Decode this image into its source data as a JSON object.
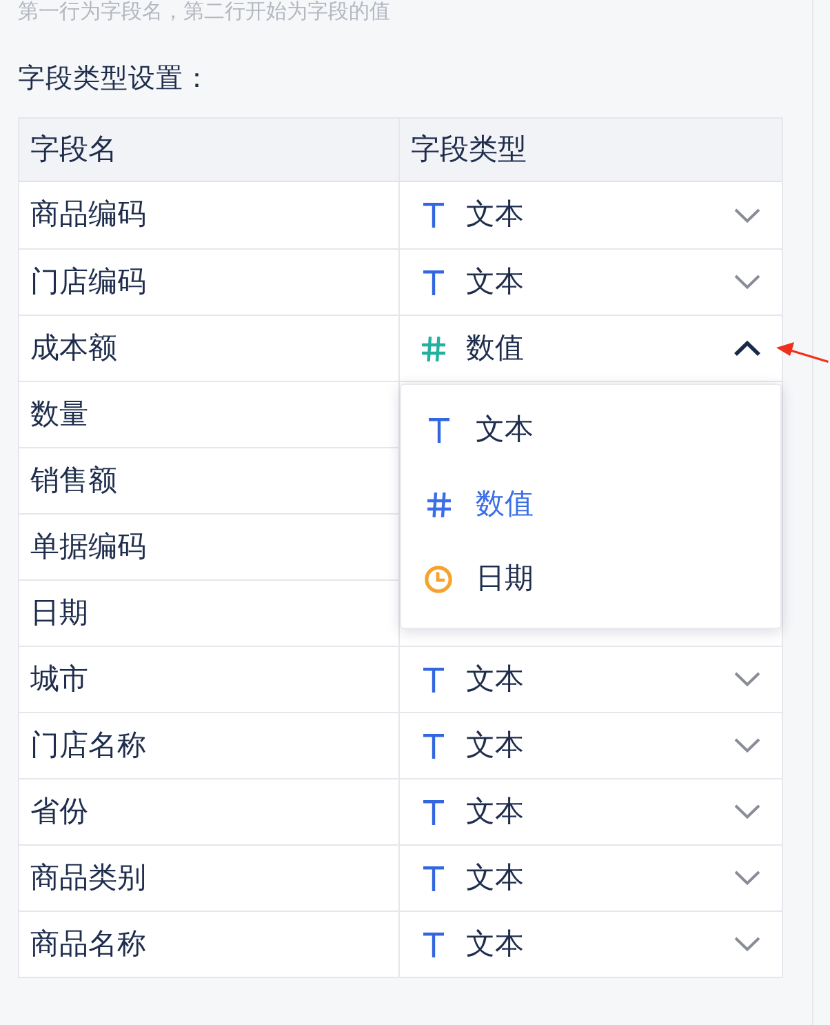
{
  "note": "第一行为字段名，第二行开始为字段的值",
  "section_title": "字段类型设置：",
  "table": {
    "columns": [
      "字段名",
      "字段类型"
    ],
    "rows": [
      {
        "name": "商品编码",
        "type": {
          "kind": "text",
          "label": "文本",
          "expanded": false
        }
      },
      {
        "name": "门店编码",
        "type": {
          "kind": "text",
          "label": "文本",
          "expanded": false
        }
      },
      {
        "name": "成本额",
        "type": {
          "kind": "number",
          "label": "数值",
          "expanded": true
        }
      },
      {
        "name": "数量"
      },
      {
        "name": "销售额"
      },
      {
        "name": "单据编码"
      },
      {
        "name": "日期"
      },
      {
        "name": "城市",
        "type": {
          "kind": "text",
          "label": "文本",
          "expanded": false
        }
      },
      {
        "name": "门店名称",
        "type": {
          "kind": "text",
          "label": "文本",
          "expanded": false
        }
      },
      {
        "name": "省份",
        "type": {
          "kind": "text",
          "label": "文本",
          "expanded": false
        }
      },
      {
        "name": "商品类别",
        "type": {
          "kind": "text",
          "label": "文本",
          "expanded": false
        }
      },
      {
        "name": "商品名称",
        "type": {
          "kind": "text",
          "label": "文本",
          "expanded": false
        }
      }
    ]
  },
  "dropdown": {
    "items": [
      {
        "kind": "text",
        "label": "文本",
        "selected": false
      },
      {
        "kind": "number",
        "label": "数值",
        "selected": true
      },
      {
        "kind": "date",
        "label": "日期",
        "selected": false
      }
    ]
  }
}
